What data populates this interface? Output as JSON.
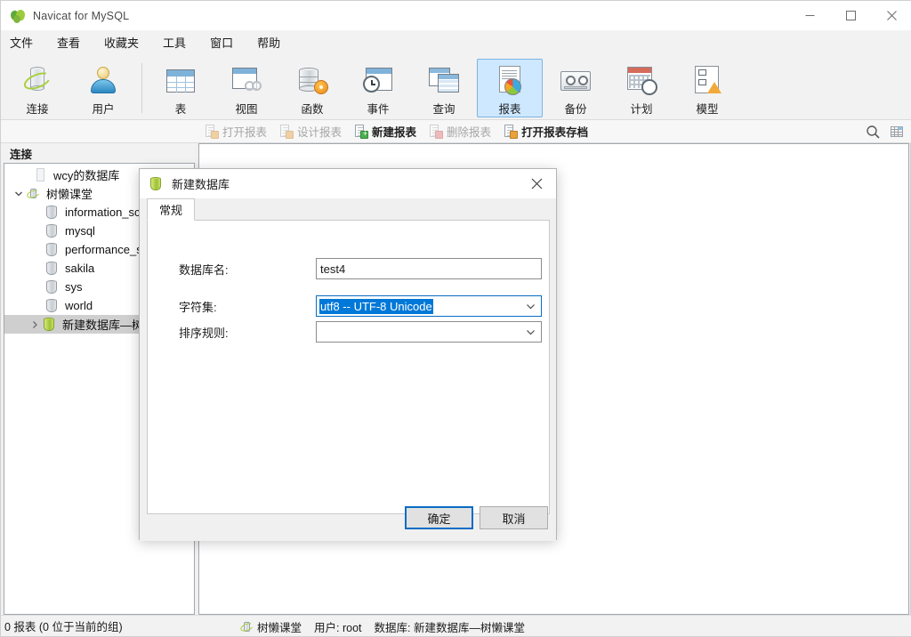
{
  "window": {
    "title": "Navicat for MySQL",
    "icon": "navicat-leaf-icon",
    "controls": {
      "minimize": "minimize-icon",
      "maximize": "maximize-icon",
      "close": "close-icon"
    }
  },
  "menubar": {
    "items": [
      {
        "label": "文件"
      },
      {
        "label": "查看"
      },
      {
        "label": "收藏夹"
      },
      {
        "label": "工具"
      },
      {
        "label": "窗口"
      },
      {
        "label": "帮助"
      }
    ]
  },
  "toolbar": {
    "items": [
      {
        "label": "连接",
        "icon": "connection-icon",
        "selected": false
      },
      {
        "label": "用户",
        "icon": "user-icon",
        "selected": false
      },
      {
        "label": "表",
        "icon": "table-icon",
        "selected": false
      },
      {
        "label": "视图",
        "icon": "view-icon",
        "selected": false
      },
      {
        "label": "函数",
        "icon": "function-icon",
        "selected": false
      },
      {
        "label": "事件",
        "icon": "event-icon",
        "selected": false
      },
      {
        "label": "查询",
        "icon": "query-icon",
        "selected": false
      },
      {
        "label": "报表",
        "icon": "report-icon",
        "selected": true
      },
      {
        "label": "备份",
        "icon": "backup-icon",
        "selected": false
      },
      {
        "label": "计划",
        "icon": "schedule-icon",
        "selected": false
      },
      {
        "label": "模型",
        "icon": "model-icon",
        "selected": false
      }
    ]
  },
  "subtoolbar": {
    "items": [
      {
        "label": "打开报表",
        "icon": "open-report-icon",
        "disabled": true,
        "strong": false
      },
      {
        "label": "设计报表",
        "icon": "design-report-icon",
        "disabled": true,
        "strong": false
      },
      {
        "label": "新建报表",
        "icon": "new-report-icon",
        "disabled": false,
        "strong": true
      },
      {
        "label": "删除报表",
        "icon": "delete-report-icon",
        "disabled": true,
        "strong": false
      },
      {
        "label": "打开报表存档",
        "icon": "open-report-archive-icon",
        "disabled": false,
        "strong": true
      }
    ],
    "right_icons": [
      {
        "name": "search-icon"
      },
      {
        "name": "grid-view-icon"
      }
    ]
  },
  "sidebar": {
    "header": "连接",
    "items": [
      {
        "label": "wcy的数据库",
        "icon": "blank-connection-icon",
        "indent": 32,
        "chevron": "none",
        "selected": false
      },
      {
        "label": "树懒课堂",
        "icon": "connection-icon",
        "indent": 10,
        "chevron": "down",
        "selected": false
      },
      {
        "label": "information_schema",
        "icon": "database-gray-icon",
        "indent": 45,
        "chevron": "none",
        "selected": false
      },
      {
        "label": "mysql",
        "icon": "database-gray-icon",
        "indent": 45,
        "chevron": "none",
        "selected": false
      },
      {
        "label": "performance_schema",
        "icon": "database-gray-icon",
        "indent": 45,
        "chevron": "none",
        "selected": false
      },
      {
        "label": "sakila",
        "icon": "database-gray-icon",
        "indent": 45,
        "chevron": "none",
        "selected": false
      },
      {
        "label": "sys",
        "icon": "database-gray-icon",
        "indent": 45,
        "chevron": "none",
        "selected": false
      },
      {
        "label": "world",
        "icon": "database-gray-icon",
        "indent": 45,
        "chevron": "none",
        "selected": false
      },
      {
        "label": "新建数据库—树",
        "icon": "database-green-icon",
        "indent": 28,
        "chevron": "right",
        "selected": true
      }
    ]
  },
  "statusbar": {
    "left": "0 报表 (0 位于当前的组)",
    "connection_icon": "connection-icon",
    "connection": "树懒课堂",
    "user": "用户: root",
    "database": "数据库: 新建数据库—树懒课堂"
  },
  "dialog": {
    "title": "新建数据库",
    "icon": "database-green-icon",
    "close_icon": "close-icon",
    "tab": "常规",
    "fields": {
      "db_name_label": "数据库名:",
      "db_name_value": "test4",
      "charset_label": "字符集:",
      "charset_value": "utf8 -- UTF-8 Unicode",
      "collation_label": "排序规则:",
      "collation_value": ""
    },
    "buttons": {
      "ok": "确定",
      "cancel": "取消"
    }
  },
  "colors": {
    "accent_selection": "#0078d7",
    "toolbar_selected_bg": "#cde8ff",
    "toolbar_selected_border": "#7db4e0",
    "focus_border": "#0a6cc4",
    "tree_selected_bg": "#cfcfcf"
  }
}
